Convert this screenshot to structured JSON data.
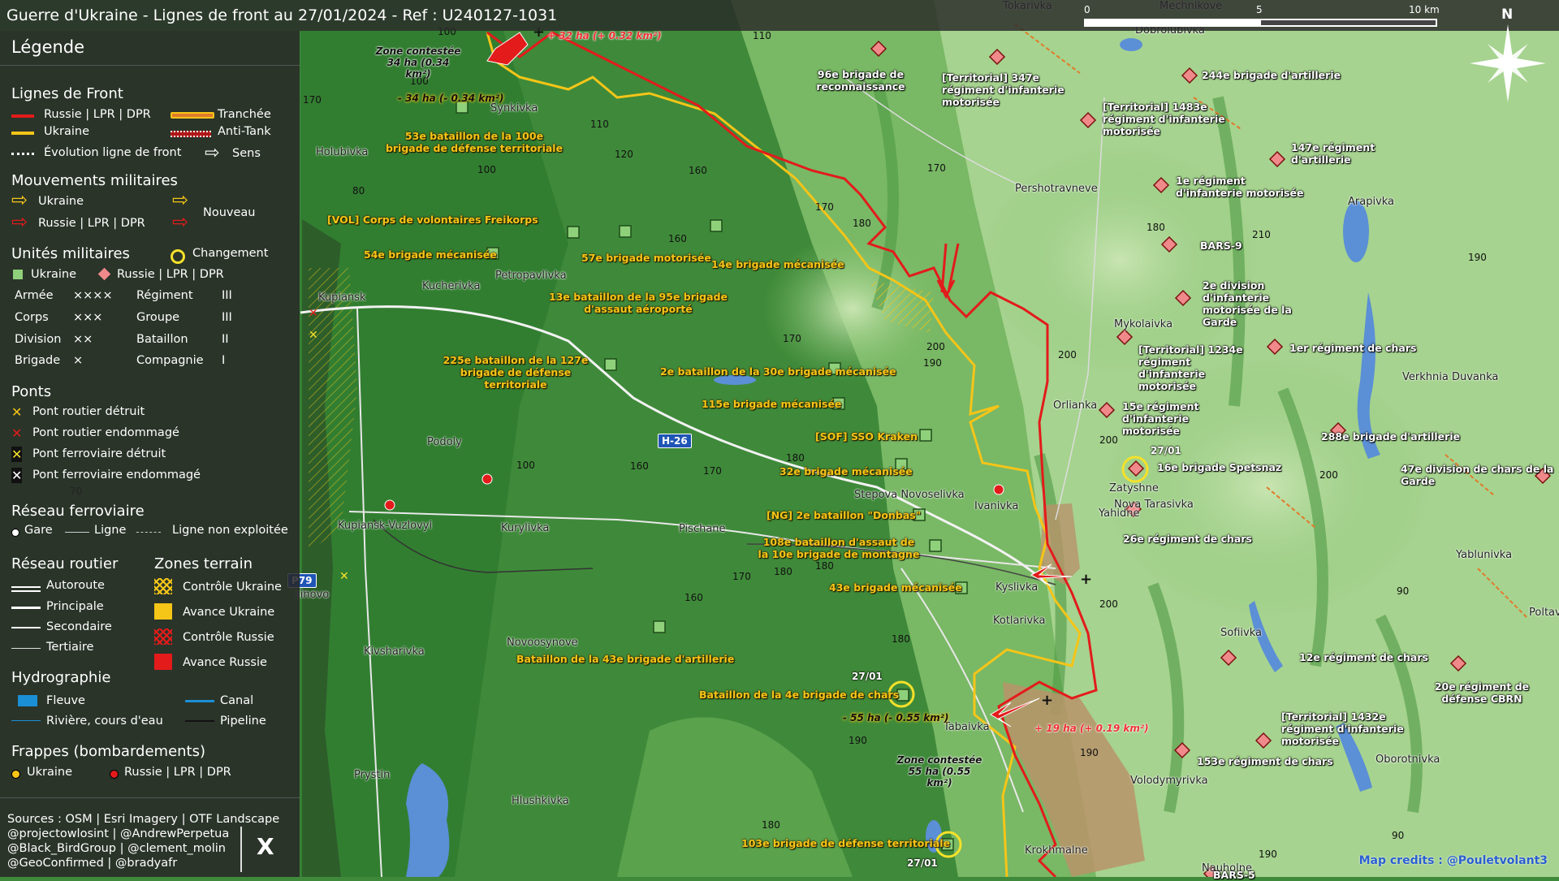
{
  "title": "Guerre d'Ukraine - Lignes de front au 27/01/2024 - Ref : U240127-1031",
  "scale": {
    "start": "0",
    "mid": "5",
    "end": "10 km"
  },
  "compass_label": "N",
  "legend": {
    "title": "Légende",
    "front": {
      "heading": "Lignes de Front",
      "russia": "Russie | LPR | DPR",
      "ukraine": "Ukraine",
      "evolution": "Évolution ligne de front",
      "trench": "Tranchée",
      "antitank": "Anti-Tank",
      "direction": "Sens"
    },
    "moves": {
      "heading": "Mouvements militaires",
      "ukraine": "Ukraine",
      "russia": "Russie | LPR | DPR",
      "new": "Nouveau"
    },
    "units": {
      "heading": "Unités militaires",
      "change": "Changement",
      "ukraine": "Ukraine",
      "russia": "Russie | LPR | DPR",
      "rows": [
        {
          "a": "Armée",
          "as": "××××",
          "b": "Régiment",
          "bs": "III"
        },
        {
          "a": "Corps",
          "as": "×××",
          "b": "Groupe",
          "bs": "III"
        },
        {
          "a": "Division",
          "as": "××",
          "b": "Bataillon",
          "bs": "II"
        },
        {
          "a": "Brigade",
          "as": "×",
          "b": "Compagnie",
          "bs": "I"
        }
      ]
    },
    "bridges": {
      "heading": "Ponts",
      "items": [
        "Pont routier détruit",
        "Pont routier endommagé",
        "Pont ferroviaire détruit",
        "Pont ferroviaire endommagé"
      ]
    },
    "rail": {
      "heading": "Réseau ferroviaire",
      "station": "Gare",
      "line": "Ligne",
      "unused": "Ligne non exploitée"
    },
    "roads": {
      "heading": "Réseau routier",
      "items": [
        "Autoroute",
        "Principale",
        "Secondaire",
        "Tertiaire"
      ]
    },
    "zones": {
      "heading": "Zones terrain",
      "items": [
        "Contrôle Ukraine",
        "Avance Ukraine",
        "Contrôle Russie",
        "Avance Russie"
      ]
    },
    "hydro": {
      "heading": "Hydrographie",
      "river": "Fleuve",
      "canal": "Canal",
      "stream": "Rivière, cours d'eau",
      "pipeline": "Pipeline"
    },
    "strikes": {
      "heading": "Frappes (bombardements)",
      "ukraine": "Ukraine",
      "russia": "Russie | LPR | DPR"
    },
    "sources": [
      "Sources : OSM | Esri Imagery | OTF Landscape",
      "@projectowlosint | @AndrewPerpetua",
      "@Black_BirdGroup | @clement_molin",
      "@GeoConfirmed | @bradyafr"
    ],
    "x_logo": "X"
  },
  "credit": "Map credits : @Pouletvolant3",
  "colors": {
    "russia": "#e31b1b",
    "ukraine": "#f5c518",
    "legend_bg": "#262626",
    "land": "#3f8a3a",
    "water": "#5b8fd6"
  },
  "road_signs": [
    "H-26",
    "P79"
  ],
  "towns": [
    "Tokarivka",
    "Mechnikove",
    "Dobrolubivka",
    "Synkivka",
    "Holubivka",
    "Pershotravneve",
    "Arapivka",
    "Kucherivka",
    "Petropavlivka",
    "Kupiansk",
    "Mykolaivka",
    "Orlianka",
    "Verkhnia Duvanka",
    "Podoly",
    "Stepova Novoselivka",
    "Ivanivka",
    "Zatyshne",
    "Yahidne",
    "Nova Tarasivka",
    "Kupiansk-Vuzlovyi",
    "Kurylivka",
    "Pischane",
    "Yablunivka",
    "Kyslivka",
    "Kotlarivka",
    "Sofiivka",
    "Kivsharivka",
    "Novoosynove",
    "Tabaivka",
    "Oborotnivka",
    "Volodymyrivka",
    "Prystin",
    "Hlushkivka",
    "Krokhmalne",
    "Nauholne",
    "Poltav",
    "sinovo"
  ],
  "elevations": [
    "100",
    "110",
    "100",
    "170",
    "80",
    "110",
    "120",
    "100",
    "160",
    "170",
    "180",
    "160",
    "170",
    "180",
    "210",
    "200",
    "190",
    "170",
    "200",
    "190",
    "200",
    "200",
    "180",
    "160",
    "100",
    "170",
    "180",
    "70",
    "170",
    "180",
    "160",
    "200",
    "190",
    "190",
    "180",
    "90",
    "190",
    "90",
    "180"
  ],
  "ukr_units": [
    "53e bataillon de la 100e brigade de défense territoriale",
    "[VOL] Corps de volontaires Freikorps",
    "54e brigade mécanisée",
    "57e brigade motorisée",
    "14e brigade mécanisée",
    "13e bataillon de la 95e brigade d'assaut aéroporté",
    "225e bataillon de la 127e brigade de défense territoriale",
    "2e bataillon de la 30e brigade mécanisée",
    "115e brigade mécanisée",
    "[SOF] SSO Kraken",
    "32e brigade mécanisée",
    "[NG] 2e bataillon \"Donbas\"",
    "108e bataillon d'assaut de la 10e brigade de montagne",
    "43e brigade mécanisée",
    "Bataillon de la 43e brigade d'artillerie",
    "Bataillon de la 4e brigade de chars",
    "103e brigade de défense territoriale"
  ],
  "ru_units": [
    "96e brigade de reconnaissance",
    "[Territorial] 347e régiment d'infanterie motorisée",
    "244e brigade d'artillerie",
    "[Territorial] 1483e régiment d'infanterie motorisée",
    "147e régiment d'artillerie",
    "1e régiment d'infanterie motorisée",
    "BARS-9",
    "2e division d'infanterie motorisée de la Garde",
    "[Territorial] 1234e régiment d'infanterie motorisée",
    "1er régiment de chars",
    "15e régiment d'infanterie motorisée",
    "288e brigade d'artillerie",
    "16e brigade Spetsnaz",
    "47e division de chars de la Garde",
    "26e régiment de chars",
    "12e régiment de chars",
    "20e régiment de défense CBRN",
    "[Territorial] 1432e régiment d'infanterie motorisée",
    "153e régiment de chars",
    "BARS-5"
  ],
  "notes": {
    "zone1": "Zone contestée 34 ha (0.34 km²)",
    "gain1": "+ 32 ha (+ 0.32 km²)",
    "loss1": "- 34 ha (- 0.34 km²)",
    "zone2": "Zone contestée 55 ha (0.55 km²)",
    "loss2": "- 55 ha (- 0.55 km²)",
    "gain2": "+ 19 ha (+ 0.19 km²)",
    "date": "27/01"
  }
}
